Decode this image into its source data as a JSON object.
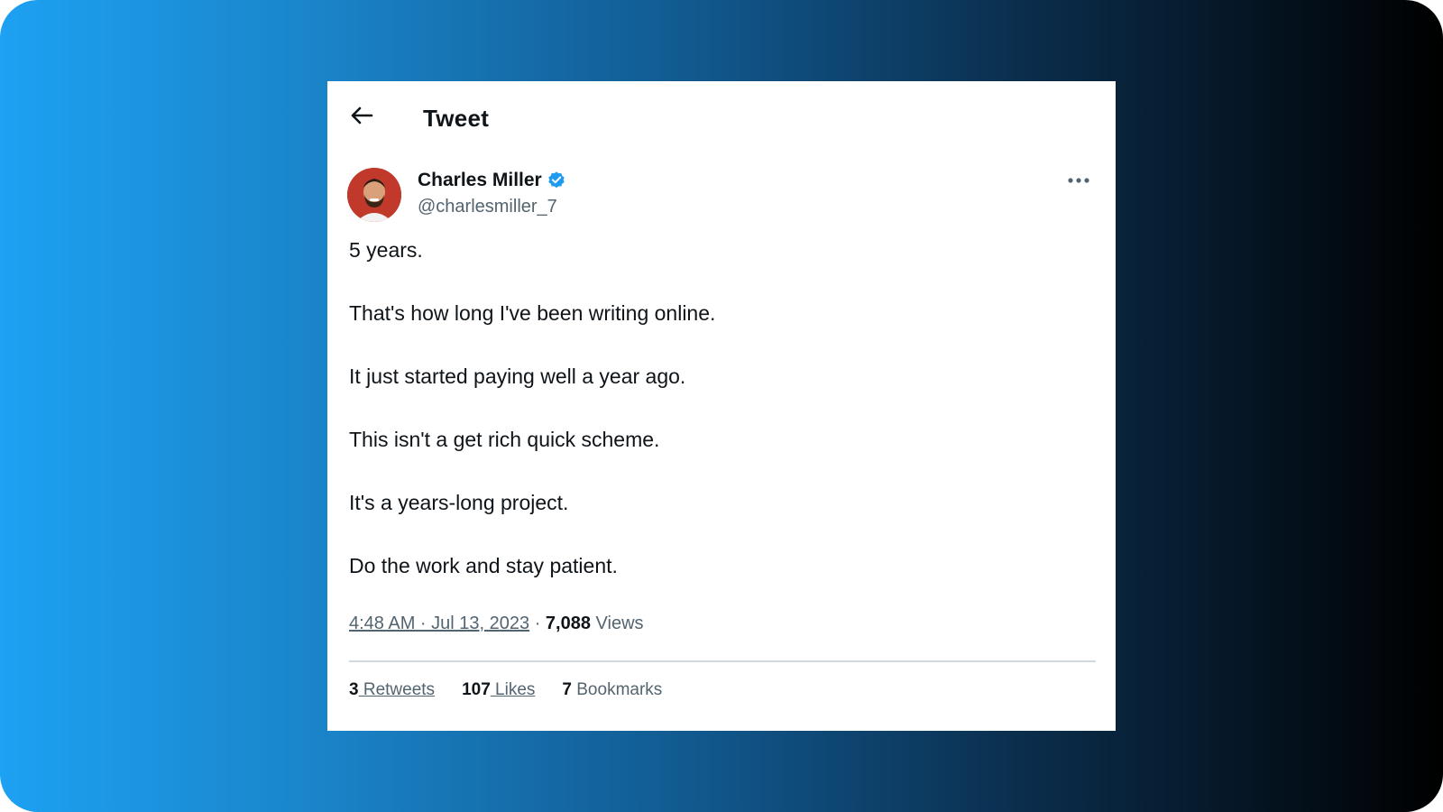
{
  "colors": {
    "verified_badge": "#1d9bf0",
    "text_primary": "#0f1419",
    "text_secondary": "#536471",
    "divider": "#cfd9de"
  },
  "header": {
    "back_icon": "arrow-left-icon",
    "title": "Tweet"
  },
  "author": {
    "name": "Charles Miller",
    "verified_icon": "verified-badge-icon",
    "handle": "@charlesmiller_7"
  },
  "more_icon": "more-horizontal-icon",
  "tweet": {
    "lines": [
      "5 years.",
      "That's how long I've been writing online.",
      "It just started paying well a year ago.",
      "This isn't a get rich quick scheme.",
      "It's a years-long project.",
      "Do the work and stay patient."
    ]
  },
  "meta": {
    "timestamp": "4:48 AM · Jul 13, 2023",
    "separator": " · ",
    "views_count": "7,088",
    "views_label": " Views"
  },
  "stats": {
    "retweets_count": "3",
    "retweets_label": " Retweets",
    "likes_count": "107",
    "likes_label": " Likes",
    "bookmarks_count": "7",
    "bookmarks_label": " Bookmarks"
  }
}
